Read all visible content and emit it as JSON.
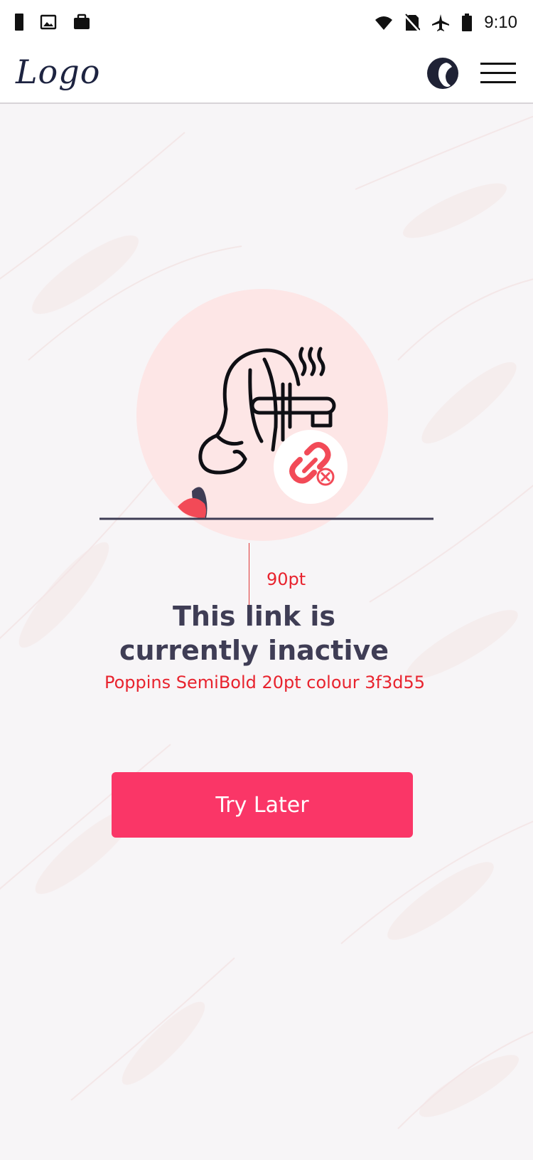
{
  "status_bar": {
    "time": "9:10",
    "left_icons": [
      "sim-icon",
      "image-icon",
      "briefcase-icon"
    ],
    "right_icons": [
      "wifi-icon",
      "no-sim-icon",
      "airplane-icon",
      "battery-icon"
    ]
  },
  "header": {
    "logo_text": "Logo",
    "avatar_icon": "profile-avatar-icon",
    "menu_icon": "hamburger-menu-icon"
  },
  "illustration": {
    "main_icon": "woman-hair-straightener-icon",
    "badge_icon": "broken-link-icon",
    "colors": {
      "circle": "#fde6e6",
      "accent": "#fa3667",
      "dark": "#3f3d55"
    }
  },
  "annotations": {
    "spacing": "90pt",
    "font_note": "Poppins SemiBold 20pt colour 3f3d55"
  },
  "message": {
    "line1": "This link is",
    "line2": "currently inactive"
  },
  "actions": {
    "try_later_label": "Try Later",
    "button_color": "#fa3667"
  }
}
